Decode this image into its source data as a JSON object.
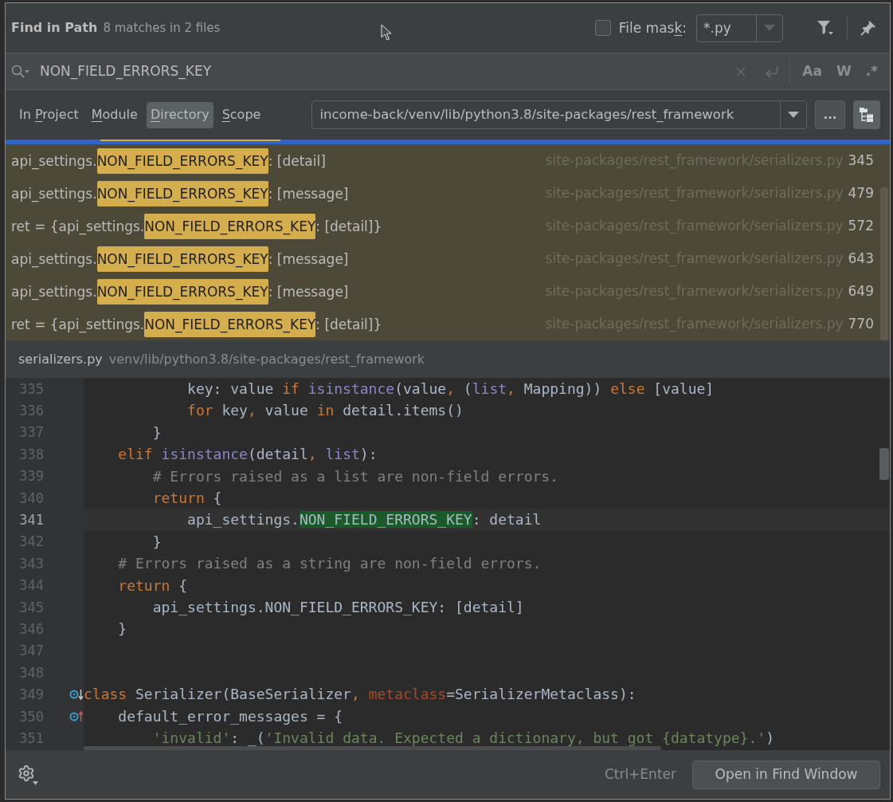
{
  "window": {
    "title": "Find in Path",
    "match_summary": "8 matches in 2 files"
  },
  "file_mask": {
    "checked": false,
    "label_parts": [
      {
        "text": "File mas",
        "underlined": false
      },
      {
        "text": "k",
        "underlined": true
      },
      {
        "text": ":",
        "underlined": false
      }
    ],
    "value": "*.py"
  },
  "search": {
    "value": "NON_FIELD_ERRORS_KEY",
    "options": [
      {
        "label": "Aa",
        "on": false
      },
      {
        "label": "W",
        "on": false
      },
      {
        "label": ".*",
        "on": false
      }
    ]
  },
  "scope_tabs": [
    {
      "label_parts": [
        {
          "text": "In ",
          "underlined": false
        },
        {
          "text": "P",
          "underlined": true
        },
        {
          "text": "roject",
          "underlined": false
        }
      ],
      "selected": false
    },
    {
      "label_parts": [
        {
          "text": "M",
          "underlined": true
        },
        {
          "text": "odule",
          "underlined": false
        }
      ],
      "selected": false
    },
    {
      "label_parts": [
        {
          "text": "D",
          "underlined": true
        },
        {
          "text": "irectory",
          "underlined": false
        }
      ],
      "selected": true
    },
    {
      "label_parts": [
        {
          "text": "S",
          "underlined": true
        },
        {
          "text": "cope",
          "underlined": false
        }
      ],
      "selected": false
    }
  ],
  "directory": {
    "value": "income-back/venv/lib/python3.8/site-packages/rest_framework",
    "browse_label": "...",
    "tree_toggle_on": true
  },
  "results": {
    "partial_row": {
      "selected": true
    },
    "rows": [
      {
        "prefix": "api_settings.",
        "match": "NON_FIELD_ERRORS_KEY",
        "suffix": ": [detail]",
        "path": "site-packages/rest_framework/serializers.py",
        "line": "345",
        "selected": false
      },
      {
        "prefix": "api_settings.",
        "match": "NON_FIELD_ERRORS_KEY",
        "suffix": ": [message]",
        "path": "site-packages/rest_framework/serializers.py",
        "line": "479",
        "selected": false
      },
      {
        "prefix": "ret = {api_settings.",
        "match": "NON_FIELD_ERRORS_KEY",
        "suffix": ": [detail]}",
        "path": "site-packages/rest_framework/serializers.py",
        "line": "572",
        "selected": false
      },
      {
        "prefix": "api_settings.",
        "match": "NON_FIELD_ERRORS_KEY",
        "suffix": ": [message]",
        "path": "site-packages/rest_framework/serializers.py",
        "line": "643",
        "selected": false
      },
      {
        "prefix": "api_settings.",
        "match": "NON_FIELD_ERRORS_KEY",
        "suffix": ": [message]",
        "path": "site-packages/rest_framework/serializers.py",
        "line": "649",
        "selected": false
      },
      {
        "prefix": "ret = {api_settings.",
        "match": "NON_FIELD_ERRORS_KEY",
        "suffix": ": [detail]}",
        "path": "site-packages/rest_framework/serializers.py",
        "line": "770",
        "selected": false
      }
    ]
  },
  "preview": {
    "file": "serializers.py",
    "path": "venv/lib/python3.8/site-packages/rest_framework",
    "lines": [
      {
        "number": "335",
        "current": false,
        "tokens": [
          {
            "text": "            key: value ",
            "kind": "plain"
          },
          {
            "text": "if ",
            "kind": "keyword"
          },
          {
            "text": "isinstance",
            "kind": "builtin"
          },
          {
            "text": "(value",
            "kind": "plain"
          },
          {
            "text": ", ",
            "kind": "keyword"
          },
          {
            "text": "(",
            "kind": "plain"
          },
          {
            "text": "list",
            "kind": "builtin"
          },
          {
            "text": ", ",
            "kind": "keyword"
          },
          {
            "text": "Mapping)) ",
            "kind": "plain"
          },
          {
            "text": "else",
            "kind": "keyword"
          },
          {
            "text": " [value]",
            "kind": "plain"
          }
        ]
      },
      {
        "number": "336",
        "current": false,
        "tokens": [
          {
            "text": "            for",
            "kind": "keyword"
          },
          {
            "text": " key",
            "kind": "plain"
          },
          {
            "text": ", ",
            "kind": "keyword"
          },
          {
            "text": "value ",
            "kind": "plain"
          },
          {
            "text": "in",
            "kind": "keyword"
          },
          {
            "text": " detail.items()",
            "kind": "plain"
          }
        ]
      },
      {
        "number": "337",
        "current": false,
        "tokens": [
          {
            "text": "        }",
            "kind": "plain"
          }
        ]
      },
      {
        "number": "338",
        "current": false,
        "tokens": [
          {
            "text": "    elif ",
            "kind": "keyword"
          },
          {
            "text": "isinstance",
            "kind": "builtin"
          },
          {
            "text": "(detail",
            "kind": "plain"
          },
          {
            "text": ", ",
            "kind": "keyword"
          },
          {
            "text": "list",
            "kind": "builtin"
          },
          {
            "text": "):",
            "kind": "plain"
          }
        ]
      },
      {
        "number": "339",
        "current": false,
        "tokens": [
          {
            "text": "        # Errors raised as a list are non-field errors.",
            "kind": "comment"
          }
        ]
      },
      {
        "number": "340",
        "current": false,
        "tokens": [
          {
            "text": "        return",
            "kind": "keyword"
          },
          {
            "text": " {",
            "kind": "plain"
          }
        ]
      },
      {
        "number": "341",
        "current": true,
        "tokens": [
          {
            "text": "            api_settings.",
            "kind": "plain"
          },
          {
            "text": "NON_FIELD_ERRORS_KEY",
            "kind": "match"
          },
          {
            "text": ": detail",
            "kind": "plain"
          }
        ]
      },
      {
        "number": "342",
        "current": false,
        "tokens": [
          {
            "text": "        }",
            "kind": "plain"
          }
        ]
      },
      {
        "number": "343",
        "current": false,
        "tokens": [
          {
            "text": "    # Errors raised as a string are non-field errors.",
            "kind": "comment"
          }
        ]
      },
      {
        "number": "344",
        "current": false,
        "tokens": [
          {
            "text": "    return",
            "kind": "keyword"
          },
          {
            "text": " {",
            "kind": "plain"
          }
        ]
      },
      {
        "number": "345",
        "current": false,
        "tokens": [
          {
            "text": "        api_settings.NON_FIELD_ERRORS_KEY: [detail]",
            "kind": "plain"
          }
        ]
      },
      {
        "number": "346",
        "current": false,
        "tokens": [
          {
            "text": "    }",
            "kind": "plain"
          }
        ]
      },
      {
        "number": "347",
        "current": false
      },
      {
        "number": "348",
        "current": false
      },
      {
        "number": "349",
        "current": false,
        "gutter_marker": {
          "kind": "down"
        },
        "tokens": [
          {
            "text": "class",
            "kind": "keyword"
          },
          {
            "text": " Serializer(BaseSerializer",
            "kind": "plain"
          },
          {
            "text": ", ",
            "kind": "keyword"
          },
          {
            "text": "metaclass",
            "kind": "param"
          },
          {
            "text": "=SerializerMetaclass):",
            "kind": "plain"
          }
        ]
      },
      {
        "number": "350",
        "current": false,
        "gutter_marker": {
          "kind": "up"
        },
        "tokens": [
          {
            "text": "    default_error_messages = {",
            "kind": "plain"
          }
        ]
      },
      {
        "number": "351",
        "current": false,
        "tokens": [
          {
            "text": "        'invalid'",
            "kind": "string"
          },
          {
            "text": ": _(",
            "kind": "plain"
          },
          {
            "text": "'Invalid data. Expected a dictionary, but got {datatype}.'",
            "kind": "string"
          },
          {
            "text": ")",
            "kind": "plain"
          }
        ]
      }
    ]
  },
  "footer": {
    "shortcut": "Ctrl+Enter",
    "button": "Open in Find Window"
  }
}
